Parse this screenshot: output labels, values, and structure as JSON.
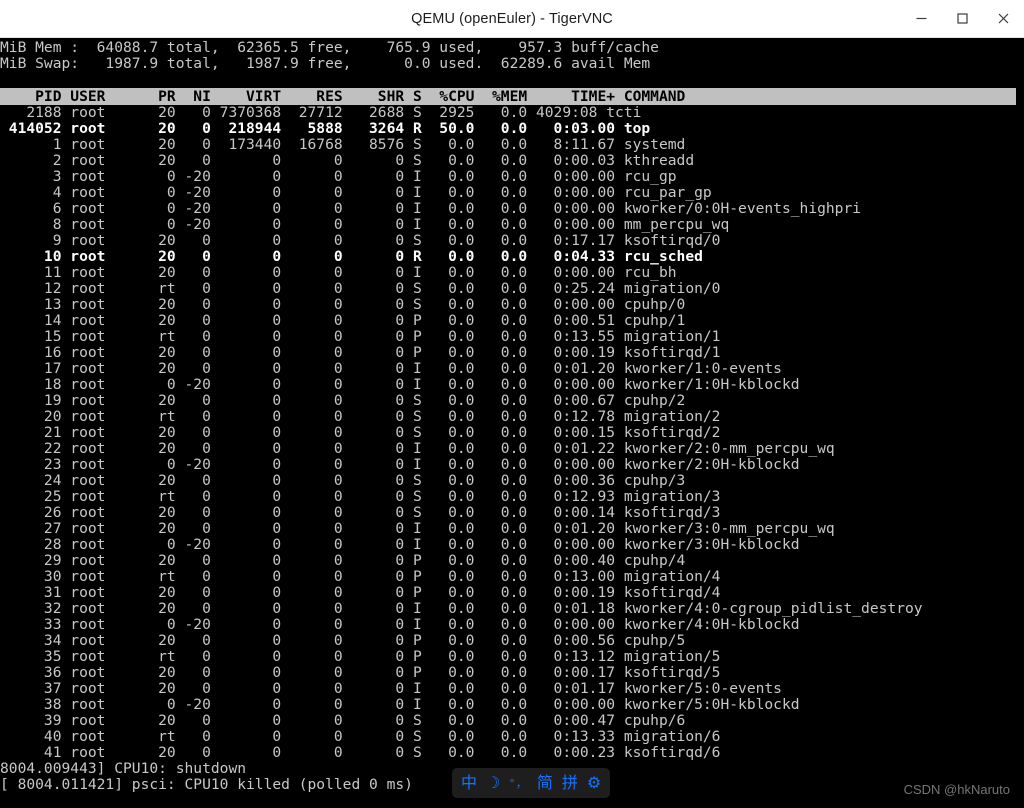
{
  "window": {
    "title": "QEMU (openEuler) - TigerVNC",
    "controls": [
      {
        "name": "minimize",
        "glyph": "minimize-icon"
      },
      {
        "name": "maximize",
        "glyph": "maximize-icon"
      },
      {
        "name": "close",
        "glyph": "close-icon"
      }
    ]
  },
  "terminal": {
    "summary": [
      "MiB Mem :  64088.7 total,  62365.5 free,    765.9 used,    957.3 buff/cache",
      "MiB Swap:   1987.9 total,   1987.9 free,      0.0 used.  62289.6 avail Mem"
    ],
    "mem": {
      "label": "MiB Mem :",
      "total": "64088.7",
      "free": "62365.5",
      "used": "765.9",
      "buff_cache": "957.3"
    },
    "swap": {
      "label": "MiB Swap:",
      "total": "1987.9",
      "free": "1987.9",
      "used": "0.0",
      "avail_mem": "62289.6"
    },
    "columns_line": "    PID USER      PR  NI    VIRT    RES    SHR S  %CPU  %MEM     TIME+ COMMAND",
    "columns": [
      "PID",
      "USER",
      "PR",
      "NI",
      "VIRT",
      "RES",
      "SHR",
      "S",
      "%CPU",
      "%MEM",
      "TIME+",
      "COMMAND"
    ],
    "rows": [
      {
        "line": "   2188 root      20   0 7370368  27712   2688 S  2925   0.0 4029:08 tcti",
        "bold": false,
        "pid": "2188",
        "user": "root",
        "pr": "20",
        "ni": "0",
        "virt": "7370368",
        "res": "27712",
        "shr": "2688",
        "s": "S",
        "cpu": "2925",
        "mem": "0.0",
        "time": "4029:08",
        "command": "tcti"
      },
      {
        "line": " 414052 root      20   0  218944   5888   3264 R  50.0   0.0   0:03.00 top",
        "bold": true,
        "pid": "414052",
        "user": "root",
        "pr": "20",
        "ni": "0",
        "virt": "218944",
        "res": "5888",
        "shr": "3264",
        "s": "R",
        "cpu": "50.0",
        "mem": "0.0",
        "time": "0:03.00",
        "command": "top"
      },
      {
        "line": "      1 root      20   0  173440  16768   8576 S   0.0   0.0   8:11.67 systemd",
        "bold": false,
        "pid": "1",
        "user": "root",
        "pr": "20",
        "ni": "0",
        "virt": "173440",
        "res": "16768",
        "shr": "8576",
        "s": "S",
        "cpu": "0.0",
        "mem": "0.0",
        "time": "8:11.67",
        "command": "systemd"
      },
      {
        "line": "      2 root      20   0       0      0      0 S   0.0   0.0   0:00.03 kthreadd",
        "bold": false,
        "pid": "2",
        "user": "root",
        "pr": "20",
        "ni": "0",
        "virt": "0",
        "res": "0",
        "shr": "0",
        "s": "S",
        "cpu": "0.0",
        "mem": "0.0",
        "time": "0:00.03",
        "command": "kthreadd"
      },
      {
        "line": "      3 root       0 -20       0      0      0 I   0.0   0.0   0:00.00 rcu_gp",
        "bold": false,
        "pid": "3",
        "user": "root",
        "pr": "0",
        "ni": "-20",
        "virt": "0",
        "res": "0",
        "shr": "0",
        "s": "I",
        "cpu": "0.0",
        "mem": "0.0",
        "time": "0:00.00",
        "command": "rcu_gp"
      },
      {
        "line": "      4 root       0 -20       0      0      0 I   0.0   0.0   0:00.00 rcu_par_gp",
        "bold": false,
        "pid": "4",
        "user": "root",
        "pr": "0",
        "ni": "-20",
        "virt": "0",
        "res": "0",
        "shr": "0",
        "s": "I",
        "cpu": "0.0",
        "mem": "0.0",
        "time": "0:00.00",
        "command": "rcu_par_gp"
      },
      {
        "line": "      6 root       0 -20       0      0      0 I   0.0   0.0   0:00.00 kworker/0:0H-events_highpri",
        "bold": false,
        "pid": "6",
        "user": "root",
        "pr": "0",
        "ni": "-20",
        "virt": "0",
        "res": "0",
        "shr": "0",
        "s": "I",
        "cpu": "0.0",
        "mem": "0.0",
        "time": "0:00.00",
        "command": "kworker/0:0H-events_highpri"
      },
      {
        "line": "      8 root       0 -20       0      0      0 I   0.0   0.0   0:00.00 mm_percpu_wq",
        "bold": false,
        "pid": "8",
        "user": "root",
        "pr": "0",
        "ni": "-20",
        "virt": "0",
        "res": "0",
        "shr": "0",
        "s": "I",
        "cpu": "0.0",
        "mem": "0.0",
        "time": "0:00.00",
        "command": "mm_percpu_wq"
      },
      {
        "line": "      9 root      20   0       0      0      0 S   0.0   0.0   0:17.17 ksoftirqd/0",
        "bold": false,
        "pid": "9",
        "user": "root",
        "pr": "20",
        "ni": "0",
        "virt": "0",
        "res": "0",
        "shr": "0",
        "s": "S",
        "cpu": "0.0",
        "mem": "0.0",
        "time": "0:17.17",
        "command": "ksoftirqd/0"
      },
      {
        "line": "     10 root      20   0       0      0      0 R   0.0   0.0   0:04.33 rcu_sched",
        "bold": true,
        "pid": "10",
        "user": "root",
        "pr": "20",
        "ni": "0",
        "virt": "0",
        "res": "0",
        "shr": "0",
        "s": "R",
        "cpu": "0.0",
        "mem": "0.0",
        "time": "0:04.33",
        "command": "rcu_sched"
      },
      {
        "line": "     11 root      20   0       0      0      0 I   0.0   0.0   0:00.00 rcu_bh",
        "bold": false,
        "pid": "11",
        "user": "root",
        "pr": "20",
        "ni": "0",
        "virt": "0",
        "res": "0",
        "shr": "0",
        "s": "I",
        "cpu": "0.0",
        "mem": "0.0",
        "time": "0:00.00",
        "command": "rcu_bh"
      },
      {
        "line": "     12 root      rt   0       0      0      0 S   0.0   0.0   0:25.24 migration/0",
        "bold": false,
        "pid": "12",
        "user": "root",
        "pr": "rt",
        "ni": "0",
        "virt": "0",
        "res": "0",
        "shr": "0",
        "s": "S",
        "cpu": "0.0",
        "mem": "0.0",
        "time": "0:25.24",
        "command": "migration/0"
      },
      {
        "line": "     13 root      20   0       0      0      0 S   0.0   0.0   0:00.00 cpuhp/0",
        "bold": false,
        "pid": "13",
        "user": "root",
        "pr": "20",
        "ni": "0",
        "virt": "0",
        "res": "0",
        "shr": "0",
        "s": "S",
        "cpu": "0.0",
        "mem": "0.0",
        "time": "0:00.00",
        "command": "cpuhp/0"
      },
      {
        "line": "     14 root      20   0       0      0      0 P   0.0   0.0   0:00.51 cpuhp/1",
        "bold": false,
        "pid": "14",
        "user": "root",
        "pr": "20",
        "ni": "0",
        "virt": "0",
        "res": "0",
        "shr": "0",
        "s": "P",
        "cpu": "0.0",
        "mem": "0.0",
        "time": "0:00.51",
        "command": "cpuhp/1"
      },
      {
        "line": "     15 root      rt   0       0      0      0 P   0.0   0.0   0:13.55 migration/1",
        "bold": false,
        "pid": "15",
        "user": "root",
        "pr": "rt",
        "ni": "0",
        "virt": "0",
        "res": "0",
        "shr": "0",
        "s": "P",
        "cpu": "0.0",
        "mem": "0.0",
        "time": "0:13.55",
        "command": "migration/1"
      },
      {
        "line": "     16 root      20   0       0      0      0 P   0.0   0.0   0:00.19 ksoftirqd/1",
        "bold": false,
        "pid": "16",
        "user": "root",
        "pr": "20",
        "ni": "0",
        "virt": "0",
        "res": "0",
        "shr": "0",
        "s": "P",
        "cpu": "0.0",
        "mem": "0.0",
        "time": "0:00.19",
        "command": "ksoftirqd/1"
      },
      {
        "line": "     17 root      20   0       0      0      0 I   0.0   0.0   0:01.20 kworker/1:0-events",
        "bold": false,
        "pid": "17",
        "user": "root",
        "pr": "20",
        "ni": "0",
        "virt": "0",
        "res": "0",
        "shr": "0",
        "s": "I",
        "cpu": "0.0",
        "mem": "0.0",
        "time": "0:01.20",
        "command": "kworker/1:0-events"
      },
      {
        "line": "     18 root       0 -20       0      0      0 I   0.0   0.0   0:00.00 kworker/1:0H-kblockd",
        "bold": false,
        "pid": "18",
        "user": "root",
        "pr": "0",
        "ni": "-20",
        "virt": "0",
        "res": "0",
        "shr": "0",
        "s": "I",
        "cpu": "0.0",
        "mem": "0.0",
        "time": "0:00.00",
        "command": "kworker/1:0H-kblockd"
      },
      {
        "line": "     19 root      20   0       0      0      0 S   0.0   0.0   0:00.67 cpuhp/2",
        "bold": false,
        "pid": "19",
        "user": "root",
        "pr": "20",
        "ni": "0",
        "virt": "0",
        "res": "0",
        "shr": "0",
        "s": "S",
        "cpu": "0.0",
        "mem": "0.0",
        "time": "0:00.67",
        "command": "cpuhp/2"
      },
      {
        "line": "     20 root      rt   0       0      0      0 S   0.0   0.0   0:12.78 migration/2",
        "bold": false,
        "pid": "20",
        "user": "root",
        "pr": "rt",
        "ni": "0",
        "virt": "0",
        "res": "0",
        "shr": "0",
        "s": "S",
        "cpu": "0.0",
        "mem": "0.0",
        "time": "0:12.78",
        "command": "migration/2"
      },
      {
        "line": "     21 root      20   0       0      0      0 S   0.0   0.0   0:00.15 ksoftirqd/2",
        "bold": false,
        "pid": "21",
        "user": "root",
        "pr": "20",
        "ni": "0",
        "virt": "0",
        "res": "0",
        "shr": "0",
        "s": "S",
        "cpu": "0.0",
        "mem": "0.0",
        "time": "0:00.15",
        "command": "ksoftirqd/2"
      },
      {
        "line": "     22 root      20   0       0      0      0 I   0.0   0.0   0:01.22 kworker/2:0-mm_percpu_wq",
        "bold": false,
        "pid": "22",
        "user": "root",
        "pr": "20",
        "ni": "0",
        "virt": "0",
        "res": "0",
        "shr": "0",
        "s": "I",
        "cpu": "0.0",
        "mem": "0.0",
        "time": "0:01.22",
        "command": "kworker/2:0-mm_percpu_wq"
      },
      {
        "line": "     23 root       0 -20       0      0      0 I   0.0   0.0   0:00.00 kworker/2:0H-kblockd",
        "bold": false,
        "pid": "23",
        "user": "root",
        "pr": "0",
        "ni": "-20",
        "virt": "0",
        "res": "0",
        "shr": "0",
        "s": "I",
        "cpu": "0.0",
        "mem": "0.0",
        "time": "0:00.00",
        "command": "kworker/2:0H-kblockd"
      },
      {
        "line": "     24 root      20   0       0      0      0 S   0.0   0.0   0:00.36 cpuhp/3",
        "bold": false,
        "pid": "24",
        "user": "root",
        "pr": "20",
        "ni": "0",
        "virt": "0",
        "res": "0",
        "shr": "0",
        "s": "S",
        "cpu": "0.0",
        "mem": "0.0",
        "time": "0:00.36",
        "command": "cpuhp/3"
      },
      {
        "line": "     25 root      rt   0       0      0      0 S   0.0   0.0   0:12.93 migration/3",
        "bold": false,
        "pid": "25",
        "user": "root",
        "pr": "rt",
        "ni": "0",
        "virt": "0",
        "res": "0",
        "shr": "0",
        "s": "S",
        "cpu": "0.0",
        "mem": "0.0",
        "time": "0:12.93",
        "command": "migration/3"
      },
      {
        "line": "     26 root      20   0       0      0      0 S   0.0   0.0   0:00.14 ksoftirqd/3",
        "bold": false,
        "pid": "26",
        "user": "root",
        "pr": "20",
        "ni": "0",
        "virt": "0",
        "res": "0",
        "shr": "0",
        "s": "S",
        "cpu": "0.0",
        "mem": "0.0",
        "time": "0:00.14",
        "command": "ksoftirqd/3"
      },
      {
        "line": "     27 root      20   0       0      0      0 I   0.0   0.0   0:01.20 kworker/3:0-mm_percpu_wq",
        "bold": false,
        "pid": "27",
        "user": "root",
        "pr": "20",
        "ni": "0",
        "virt": "0",
        "res": "0",
        "shr": "0",
        "s": "I",
        "cpu": "0.0",
        "mem": "0.0",
        "time": "0:01.20",
        "command": "kworker/3:0-mm_percpu_wq"
      },
      {
        "line": "     28 root       0 -20       0      0      0 I   0.0   0.0   0:00.00 kworker/3:0H-kblockd",
        "bold": false,
        "pid": "28",
        "user": "root",
        "pr": "0",
        "ni": "-20",
        "virt": "0",
        "res": "0",
        "shr": "0",
        "s": "I",
        "cpu": "0.0",
        "mem": "0.0",
        "time": "0:00.00",
        "command": "kworker/3:0H-kblockd"
      },
      {
        "line": "     29 root      20   0       0      0      0 P   0.0   0.0   0:00.40 cpuhp/4",
        "bold": false,
        "pid": "29",
        "user": "root",
        "pr": "20",
        "ni": "0",
        "virt": "0",
        "res": "0",
        "shr": "0",
        "s": "P",
        "cpu": "0.0",
        "mem": "0.0",
        "time": "0:00.40",
        "command": "cpuhp/4"
      },
      {
        "line": "     30 root      rt   0       0      0      0 P   0.0   0.0   0:13.00 migration/4",
        "bold": false,
        "pid": "30",
        "user": "root",
        "pr": "rt",
        "ni": "0",
        "virt": "0",
        "res": "0",
        "shr": "0",
        "s": "P",
        "cpu": "0.0",
        "mem": "0.0",
        "time": "0:13.00",
        "command": "migration/4"
      },
      {
        "line": "     31 root      20   0       0      0      0 P   0.0   0.0   0:00.19 ksoftirqd/4",
        "bold": false,
        "pid": "31",
        "user": "root",
        "pr": "20",
        "ni": "0",
        "virt": "0",
        "res": "0",
        "shr": "0",
        "s": "P",
        "cpu": "0.0",
        "mem": "0.0",
        "time": "0:00.19",
        "command": "ksoftirqd/4"
      },
      {
        "line": "     32 root      20   0       0      0      0 I   0.0   0.0   0:01.18 kworker/4:0-cgroup_pidlist_destroy",
        "bold": false,
        "pid": "32",
        "user": "root",
        "pr": "20",
        "ni": "0",
        "virt": "0",
        "res": "0",
        "shr": "0",
        "s": "I",
        "cpu": "0.0",
        "mem": "0.0",
        "time": "0:01.18",
        "command": "kworker/4:0-cgroup_pidlist_destroy"
      },
      {
        "line": "     33 root       0 -20       0      0      0 I   0.0   0.0   0:00.00 kworker/4:0H-kblockd",
        "bold": false,
        "pid": "33",
        "user": "root",
        "pr": "0",
        "ni": "-20",
        "virt": "0",
        "res": "0",
        "shr": "0",
        "s": "I",
        "cpu": "0.0",
        "mem": "0.0",
        "time": "0:00.00",
        "command": "kworker/4:0H-kblockd"
      },
      {
        "line": "     34 root      20   0       0      0      0 P   0.0   0.0   0:00.56 cpuhp/5",
        "bold": false,
        "pid": "34",
        "user": "root",
        "pr": "20",
        "ni": "0",
        "virt": "0",
        "res": "0",
        "shr": "0",
        "s": "P",
        "cpu": "0.0",
        "mem": "0.0",
        "time": "0:00.56",
        "command": "cpuhp/5"
      },
      {
        "line": "     35 root      rt   0       0      0      0 P   0.0   0.0   0:13.12 migration/5",
        "bold": false,
        "pid": "35",
        "user": "root",
        "pr": "rt",
        "ni": "0",
        "virt": "0",
        "res": "0",
        "shr": "0",
        "s": "P",
        "cpu": "0.0",
        "mem": "0.0",
        "time": "0:13.12",
        "command": "migration/5"
      },
      {
        "line": "     36 root      20   0       0      0      0 P   0.0   0.0   0:00.17 ksoftirqd/5",
        "bold": false,
        "pid": "36",
        "user": "root",
        "pr": "20",
        "ni": "0",
        "virt": "0",
        "res": "0",
        "shr": "0",
        "s": "P",
        "cpu": "0.0",
        "mem": "0.0",
        "time": "0:00.17",
        "command": "ksoftirqd/5"
      },
      {
        "line": "     37 root      20   0       0      0      0 I   0.0   0.0   0:01.17 kworker/5:0-events",
        "bold": false,
        "pid": "37",
        "user": "root",
        "pr": "20",
        "ni": "0",
        "virt": "0",
        "res": "0",
        "shr": "0",
        "s": "I",
        "cpu": "0.0",
        "mem": "0.0",
        "time": "0:01.17",
        "command": "kworker/5:0-events"
      },
      {
        "line": "     38 root       0 -20       0      0      0 I   0.0   0.0   0:00.00 kworker/5:0H-kblockd",
        "bold": false,
        "pid": "38",
        "user": "root",
        "pr": "0",
        "ni": "-20",
        "virt": "0",
        "res": "0",
        "shr": "0",
        "s": "I",
        "cpu": "0.0",
        "mem": "0.0",
        "time": "0:00.00",
        "command": "kworker/5:0H-kblockd"
      },
      {
        "line": "     39 root      20   0       0      0      0 S   0.0   0.0   0:00.47 cpuhp/6",
        "bold": false,
        "pid": "39",
        "user": "root",
        "pr": "20",
        "ni": "0",
        "virt": "0",
        "res": "0",
        "shr": "0",
        "s": "S",
        "cpu": "0.0",
        "mem": "0.0",
        "time": "0:00.47",
        "command": "cpuhp/6"
      },
      {
        "line": "     40 root      rt   0       0      0      0 S   0.0   0.0   0:13.33 migration/6",
        "bold": false,
        "pid": "40",
        "user": "root",
        "pr": "rt",
        "ni": "0",
        "virt": "0",
        "res": "0",
        "shr": "0",
        "s": "S",
        "cpu": "0.0",
        "mem": "0.0",
        "time": "0:13.33",
        "command": "migration/6"
      },
      {
        "line": "     41 root      20   0       0      0      0 S   0.0   0.0   0:00.23 ksoftirqd/6",
        "bold": false,
        "pid": "41",
        "user": "root",
        "pr": "20",
        "ni": "0",
        "virt": "0",
        "res": "0",
        "shr": "0",
        "s": "S",
        "cpu": "0.0",
        "mem": "0.0",
        "time": "0:00.23",
        "command": "ksoftirqd/6"
      }
    ],
    "kernel_log": [
      "8004.009443] CPU10: shutdown",
      "[ 8004.011421] psci: CPU10 killed (polled 0 ms)"
    ]
  },
  "ime_bar": {
    "items": [
      {
        "name": "input-mode-chinese",
        "label": "中"
      },
      {
        "name": "dark-mode-moon-icon",
        "label": "☽"
      },
      {
        "name": "punctuation-mode",
        "label": "°，"
      },
      {
        "name": "simplified-chinese-mode",
        "label": "简"
      },
      {
        "name": "pinyin-mode",
        "label": "拼"
      },
      {
        "name": "settings-gear-icon",
        "label": "⚙"
      }
    ],
    "accent_color": "#1673ff",
    "background_color": "#1e1e1e"
  },
  "watermark": {
    "text": "CSDN @hkNaruto"
  }
}
